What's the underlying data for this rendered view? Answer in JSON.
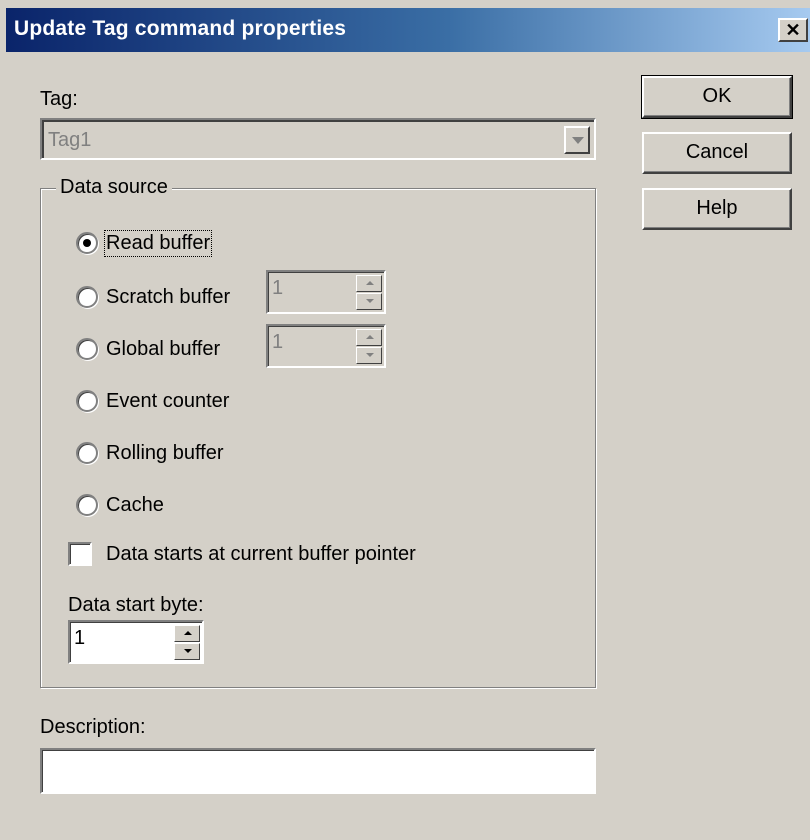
{
  "window": {
    "title": "Update Tag command properties",
    "close_glyph": "✕"
  },
  "tag": {
    "label": "Tag:",
    "value": "Tag1"
  },
  "data_source": {
    "legend": "Data source",
    "options": [
      {
        "label": "Read buffer",
        "selected": true
      },
      {
        "label": "Scratch buffer",
        "selected": false
      },
      {
        "label": "Global buffer",
        "selected": false
      },
      {
        "label": "Event counter",
        "selected": false
      },
      {
        "label": "Rolling buffer",
        "selected": false
      },
      {
        "label": "Cache",
        "selected": false
      }
    ],
    "scratch_value": "1",
    "global_value": "1",
    "checkbox_label": "Data starts at current buffer pointer",
    "checkbox_checked": false,
    "start_byte_label": "Data start byte:",
    "start_byte_value": "1"
  },
  "description": {
    "label": "Description:",
    "value": ""
  },
  "buttons": {
    "ok": "OK",
    "cancel": "Cancel",
    "help": "Help"
  }
}
